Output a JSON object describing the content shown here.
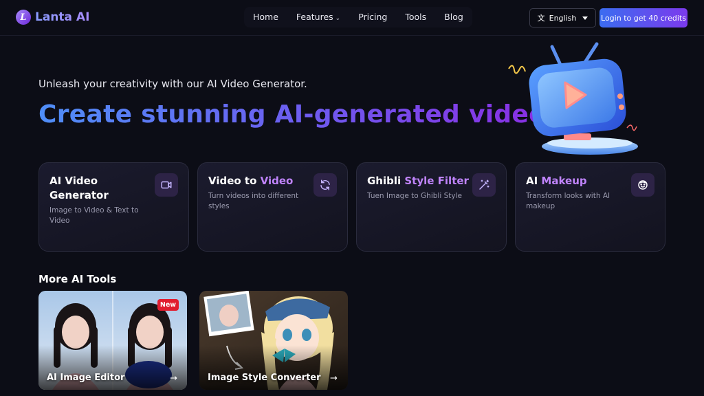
{
  "brand": {
    "name": "Lanta AI",
    "logo_letter": "L"
  },
  "nav": {
    "items": [
      {
        "label": "Home"
      },
      {
        "label": "Features",
        "has_dropdown": true
      },
      {
        "label": "Pricing"
      },
      {
        "label": "Tools"
      },
      {
        "label": "Blog"
      }
    ],
    "chevron": "⌄"
  },
  "language": {
    "selected": "English",
    "icon": "translate-icon",
    "icon_glyph": "文"
  },
  "login": {
    "label": "Login to get 40 credits"
  },
  "hero": {
    "subtitle": "Unleash your creativity with our AI Video Generator.",
    "title": "Create stunning AI-generated videos"
  },
  "features": [
    {
      "title_parts": [
        "AI Video Generator",
        ""
      ],
      "description": "Image to Video & Text to Video",
      "icon": "video-camera-icon"
    },
    {
      "title_parts": [
        "Video to ",
        "Video"
      ],
      "description": "Turn videos into different styles",
      "icon": "refresh-icon"
    },
    {
      "title_parts": [
        "Ghibli ",
        "Style Filter"
      ],
      "description": "Tuen Image to Ghibli Style",
      "icon": "magic-wand-icon"
    },
    {
      "title_parts": [
        "AI ",
        "Makeup"
      ],
      "description": "Transform looks with AI makeup",
      "icon": "face-icon"
    }
  ],
  "more_tools": {
    "title": "More AI Tools",
    "items": [
      {
        "label": "AI Image Editor",
        "badge": "New",
        "arrow": "→"
      },
      {
        "label": "Image Style Converter",
        "arrow": "→"
      }
    ]
  },
  "colors": {
    "background": "#0c0d16",
    "accent_blue": "#3b6cf0",
    "accent_purple": "#7c3aed",
    "highlight": "#c084fc",
    "badge_red": "#e11d2f"
  }
}
